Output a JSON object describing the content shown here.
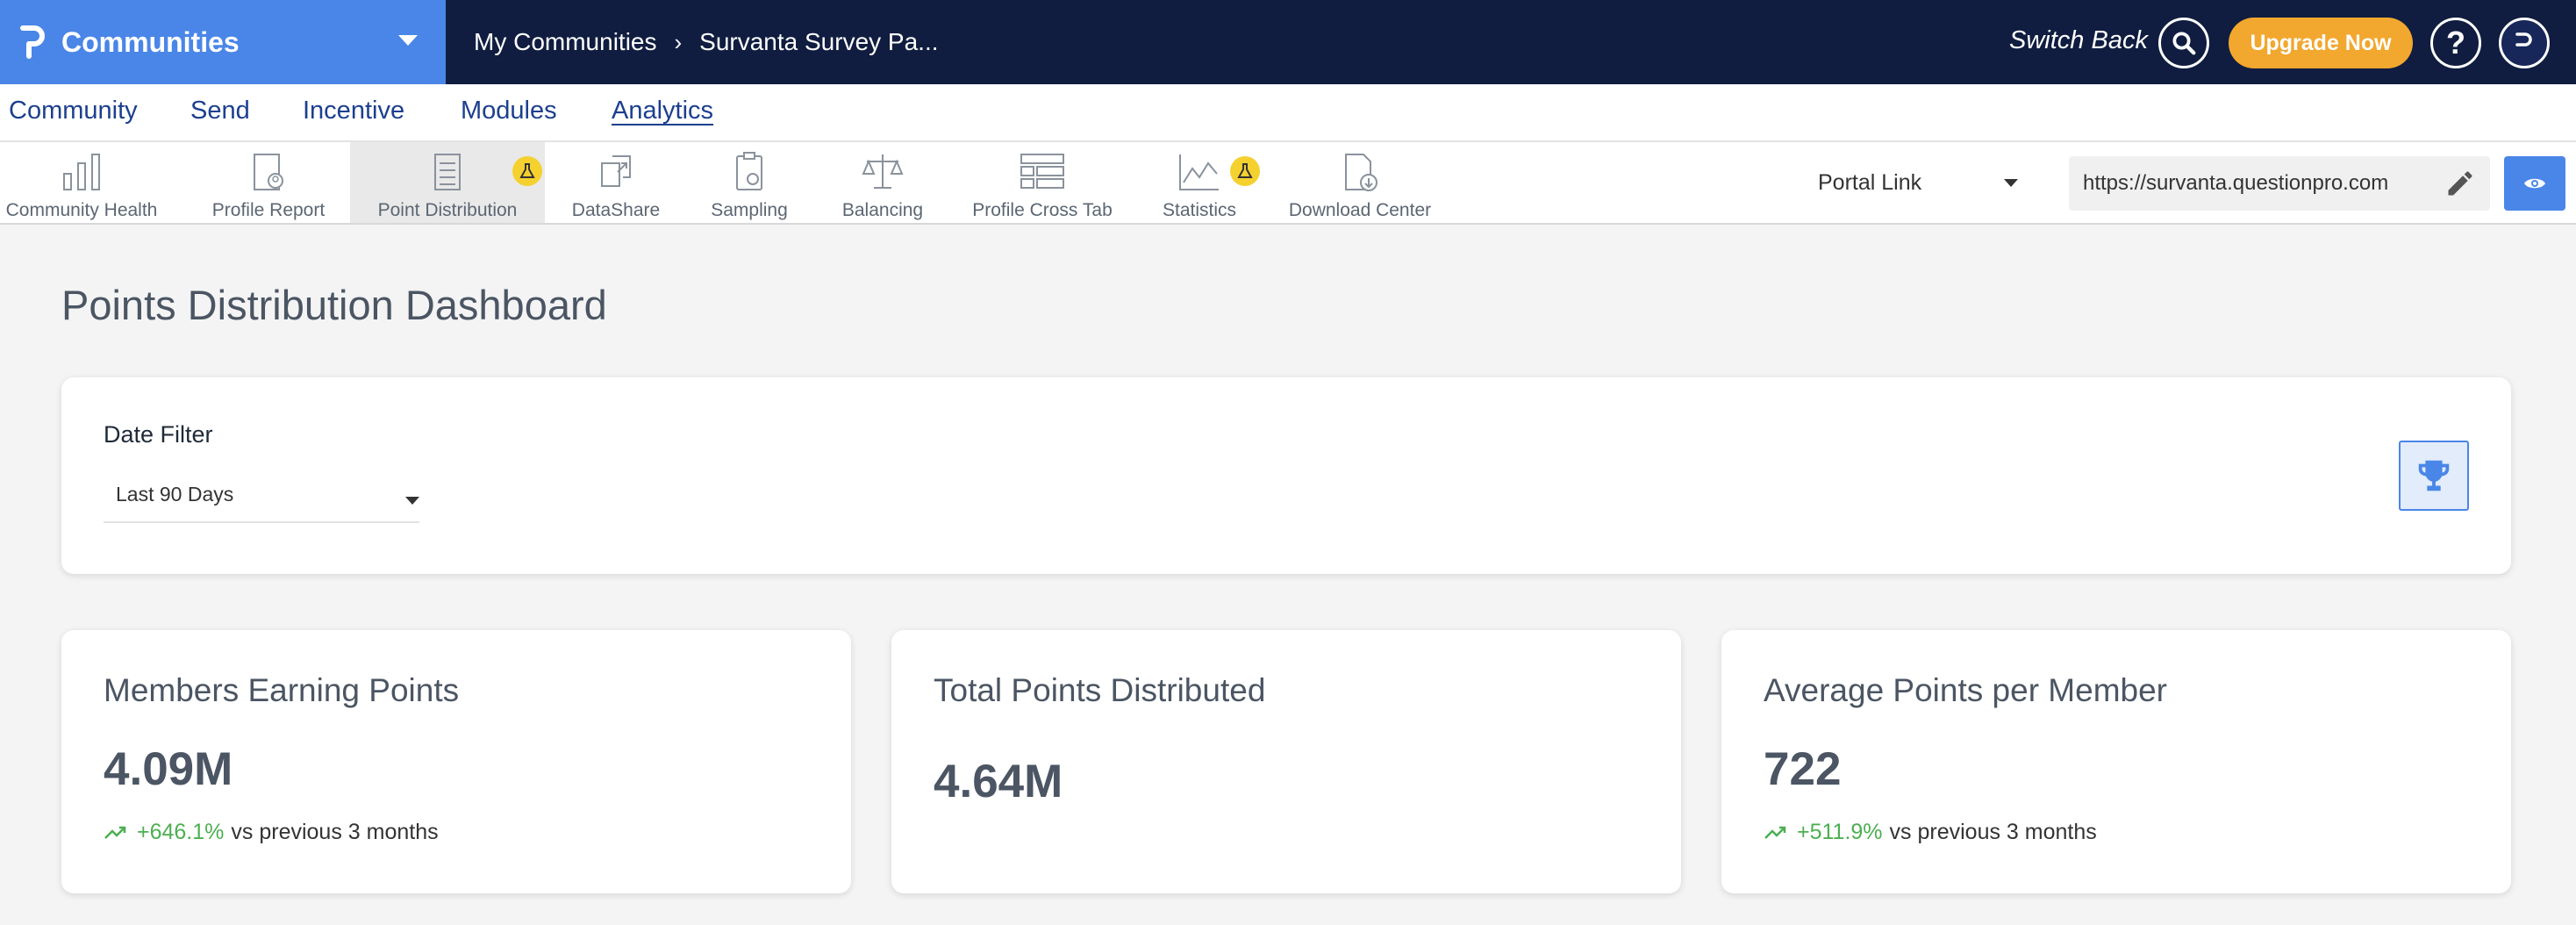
{
  "header": {
    "app_title": "Communities",
    "breadcrumb": [
      "My Communities",
      "Survanta Survey Pa..."
    ],
    "switch_back": "Switch Back",
    "upgrade_label": "Upgrade Now",
    "help_label": "?",
    "colors": {
      "brand": "#4a86e8",
      "topbar": "#101d40",
      "upgrade": "#f2a72e"
    }
  },
  "nav": {
    "items": [
      {
        "label": "Community"
      },
      {
        "label": "Send"
      },
      {
        "label": "Incentive"
      },
      {
        "label": "Modules"
      },
      {
        "label": "Analytics",
        "active": true
      }
    ]
  },
  "toolbar": {
    "tools": [
      {
        "label": "Community Health",
        "icon": "bar-chart-icon"
      },
      {
        "label": "Profile Report",
        "icon": "profile-report-icon"
      },
      {
        "label": "Point Distribution",
        "icon": "point-distribution-icon",
        "active": true,
        "beta": true
      },
      {
        "label": "DataShare",
        "icon": "datashare-icon"
      },
      {
        "label": "Sampling",
        "icon": "sampling-icon"
      },
      {
        "label": "Balancing",
        "icon": "balance-scale-icon"
      },
      {
        "label": "Profile Cross Tab",
        "icon": "cross-tab-icon"
      },
      {
        "label": "Statistics",
        "icon": "statistics-icon",
        "beta": true
      },
      {
        "label": "Download Center",
        "icon": "download-center-icon"
      }
    ],
    "portal_select": "Portal Link",
    "portal_url": "https://survanta.questionpro.com"
  },
  "page": {
    "title": "Points Distribution Dashboard",
    "filter": {
      "label": "Date Filter",
      "value": "Last 90 Days"
    },
    "metrics": [
      {
        "title": "Members Earning Points",
        "value": "4.09M",
        "trend_pct": "+646.1%",
        "trend_text": "vs previous 3 months"
      },
      {
        "title": "Total Points Distributed",
        "value": "4.64M"
      },
      {
        "title": "Average Points per Member",
        "value": "722",
        "trend_pct": "+511.9%",
        "trend_text": "vs previous 3 months"
      }
    ]
  }
}
